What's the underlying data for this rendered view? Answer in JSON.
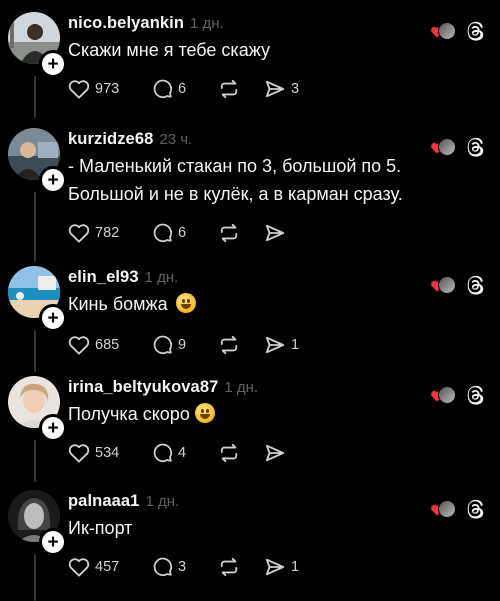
{
  "posts": [
    {
      "username": "nico.belyankin",
      "time": "1 дн.",
      "text": "Скажи мне я тебе скажу",
      "emoji": false,
      "likes": "973",
      "replies": "6",
      "shares": "3",
      "avatar": "avatar-man-outdoors"
    },
    {
      "username": "kurzidze68",
      "time": "23 ч.",
      "text": "- Маленький стакан по 3, большой по 5. Большой и не в кулёк, а в карман сразу.",
      "emoji": false,
      "likes": "782",
      "replies": "6",
      "shares": "",
      "avatar": "avatar-man-car"
    },
    {
      "username": "elin_el93",
      "time": "1 дн.",
      "text": "Кинь бомжа",
      "emoji": true,
      "likes": "685",
      "replies": "9",
      "shares": "1",
      "avatar": "avatar-beach"
    },
    {
      "username": "irina_beltyukova87",
      "time": "1 дн.",
      "text": "Получка скоро",
      "emoji": true,
      "likes": "534",
      "replies": "4",
      "shares": "",
      "avatar": "avatar-woman"
    },
    {
      "username": "palnaaa1",
      "time": "1 дн.",
      "text": "Ик-порт",
      "emoji": false,
      "likes": "457",
      "replies": "3",
      "shares": "1",
      "avatar": "avatar-woman-bw"
    }
  ],
  "icons": {
    "like": "heart-outline-icon",
    "reply": "comment-bubble-icon",
    "repost": "repost-arrows-icon",
    "share": "send-arrow-icon",
    "liked_by_author": "red-heart-icon",
    "app": "threads-logo-icon"
  },
  "colors": {
    "background": "#000000",
    "text": "#f3f5f7",
    "muted": "#616161",
    "heart": "#ff3040"
  }
}
